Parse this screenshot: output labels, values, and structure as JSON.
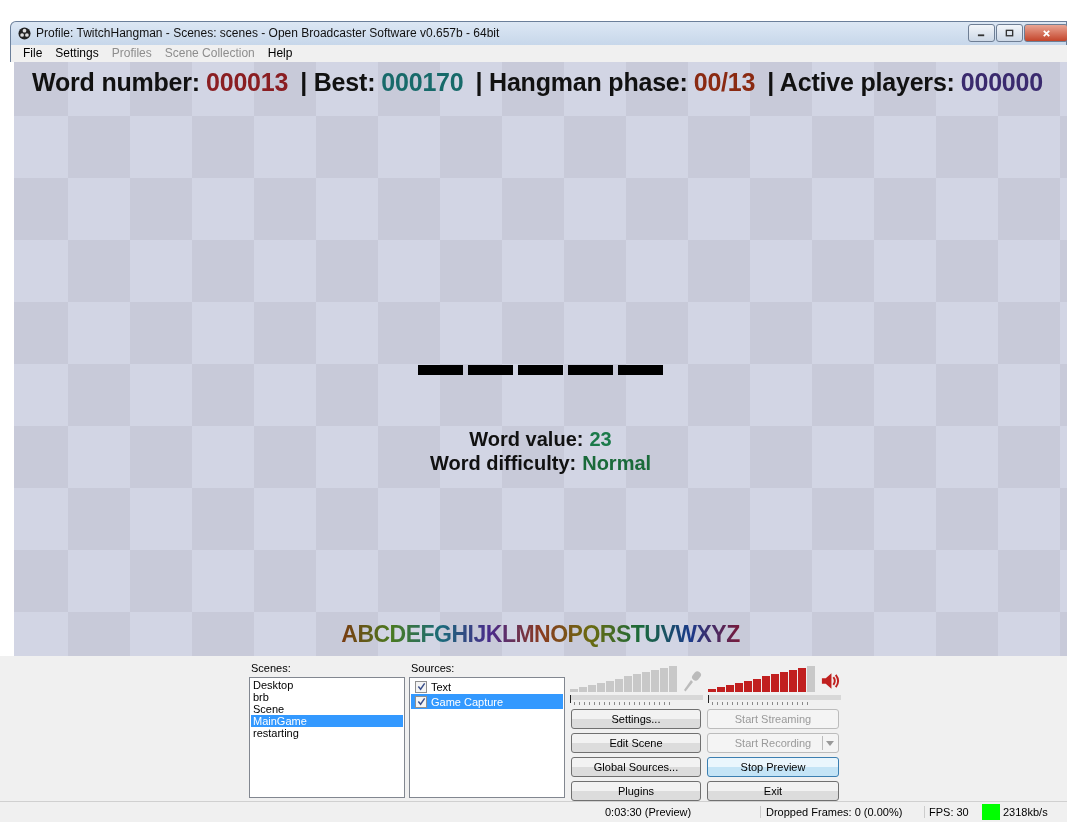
{
  "window": {
    "title": "Profile: TwitchHangman - Scenes: scenes - Open Broadcaster Software v0.657b - 64bit"
  },
  "menu": [
    {
      "label": "File",
      "disabled": false
    },
    {
      "label": "Settings",
      "disabled": false
    },
    {
      "label": "Profiles",
      "disabled": true
    },
    {
      "label": "Scene Collection",
      "disabled": true
    },
    {
      "label": "Help",
      "disabled": false
    }
  ],
  "preview": {
    "header": [
      {
        "label": "Word number:",
        "value": "000013"
      },
      {
        "label": "| Best:",
        "value": "000170"
      },
      {
        "label": "| Hangman phase:",
        "value": "00/13"
      },
      {
        "label": "| Active players:",
        "value": "000000"
      }
    ],
    "word_slots": [
      {
        "kind": "blank"
      },
      {
        "kind": "blank"
      },
      {
        "kind": "blank"
      },
      {
        "kind": "blank"
      },
      {
        "kind": "blank"
      }
    ],
    "info": [
      {
        "label": "Word value:",
        "value": "23"
      },
      {
        "label": "Word difficulty:",
        "value": "Normal"
      }
    ],
    "alphabet": "ABCDEFGHIJKLMNOPQRSTUVWXYZ"
  },
  "scenes": {
    "label": "Scenes:",
    "items": [
      {
        "label": "Desktop",
        "selected": false
      },
      {
        "label": "brb",
        "selected": false
      },
      {
        "label": "Scene",
        "selected": false
      },
      {
        "label": "MainGame",
        "selected": true
      },
      {
        "label": "restarting",
        "selected": false
      }
    ]
  },
  "sources": {
    "label": "Sources:",
    "items": [
      {
        "label": "Text",
        "checked": true,
        "selected": false
      },
      {
        "label": "Game Capture",
        "checked": true,
        "selected": true
      }
    ]
  },
  "meters": [
    {
      "kind": "microphone",
      "level": 0,
      "slider": {
        "level": 0
      }
    },
    {
      "kind": "speaker",
      "level": 0.92,
      "slider": {
        "level": 0
      }
    }
  ],
  "buttons": [
    {
      "label": "Settings...",
      "disabled": false,
      "focused": false,
      "dropdown": false
    },
    {
      "label": "Start Streaming",
      "disabled": true,
      "focused": false,
      "dropdown": false
    },
    {
      "label": "Edit Scene",
      "disabled": false,
      "focused": false,
      "dropdown": false
    },
    {
      "label": "Start Recording",
      "disabled": true,
      "focused": false,
      "dropdown": true
    },
    {
      "label": "Global Sources...",
      "disabled": false,
      "focused": false,
      "dropdown": false
    },
    {
      "label": "Stop Preview",
      "disabled": false,
      "focused": true,
      "dropdown": false
    },
    {
      "label": "Plugins",
      "disabled": false,
      "focused": false,
      "dropdown": false
    },
    {
      "label": "Exit",
      "disabled": false,
      "focused": false,
      "dropdown": false
    }
  ],
  "status_bar": {
    "time": "0:03:30 (Preview)",
    "dropped": "Dropped Frames: 0 (0.00%)",
    "fps": "FPS: 30",
    "signal": {
      "color": "#00ff00"
    },
    "bitrate": "2318kb/s"
  }
}
